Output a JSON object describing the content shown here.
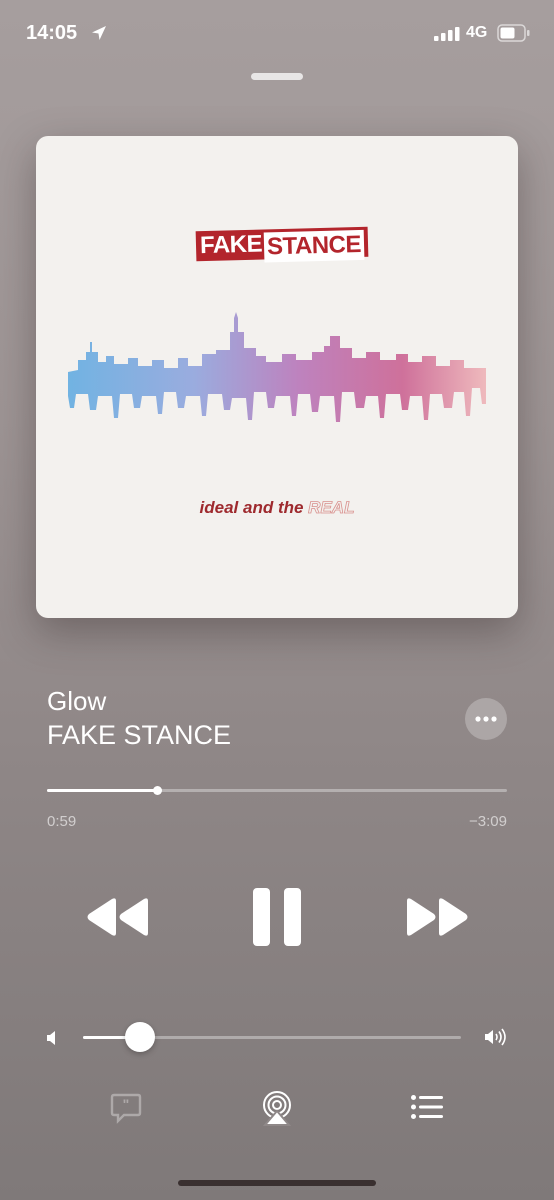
{
  "status_bar": {
    "time": "14:05",
    "network": "4G",
    "location_icon": "location-arrow-icon",
    "signal_icon": "cellular-signal-icon",
    "battery_icon": "battery-icon"
  },
  "album_art": {
    "band_logo_part1": "FAKE",
    "band_logo_part2": "STANCE",
    "subtitle_part1": "ideal and the ",
    "subtitle_part2": "REAL"
  },
  "track": {
    "title": "Glow",
    "artist": "FAKE STANCE"
  },
  "more_button": {
    "icon": "ellipsis-icon"
  },
  "progress": {
    "elapsed": "0:59",
    "remaining": "−3:09",
    "fraction": 0.24
  },
  "controls": {
    "rewind_icon": "rewind-icon",
    "pause_icon": "pause-icon",
    "forward_icon": "fast-forward-icon"
  },
  "volume": {
    "level": 0.15,
    "low_icon": "speaker-low-icon",
    "high_icon": "speaker-high-icon"
  },
  "bottom_bar": {
    "lyrics_icon": "lyrics-icon",
    "airplay_icon": "airplay-icon",
    "queue_icon": "queue-list-icon"
  },
  "colors": {
    "logo_red": "#b3252c",
    "background": "#9d9494"
  }
}
